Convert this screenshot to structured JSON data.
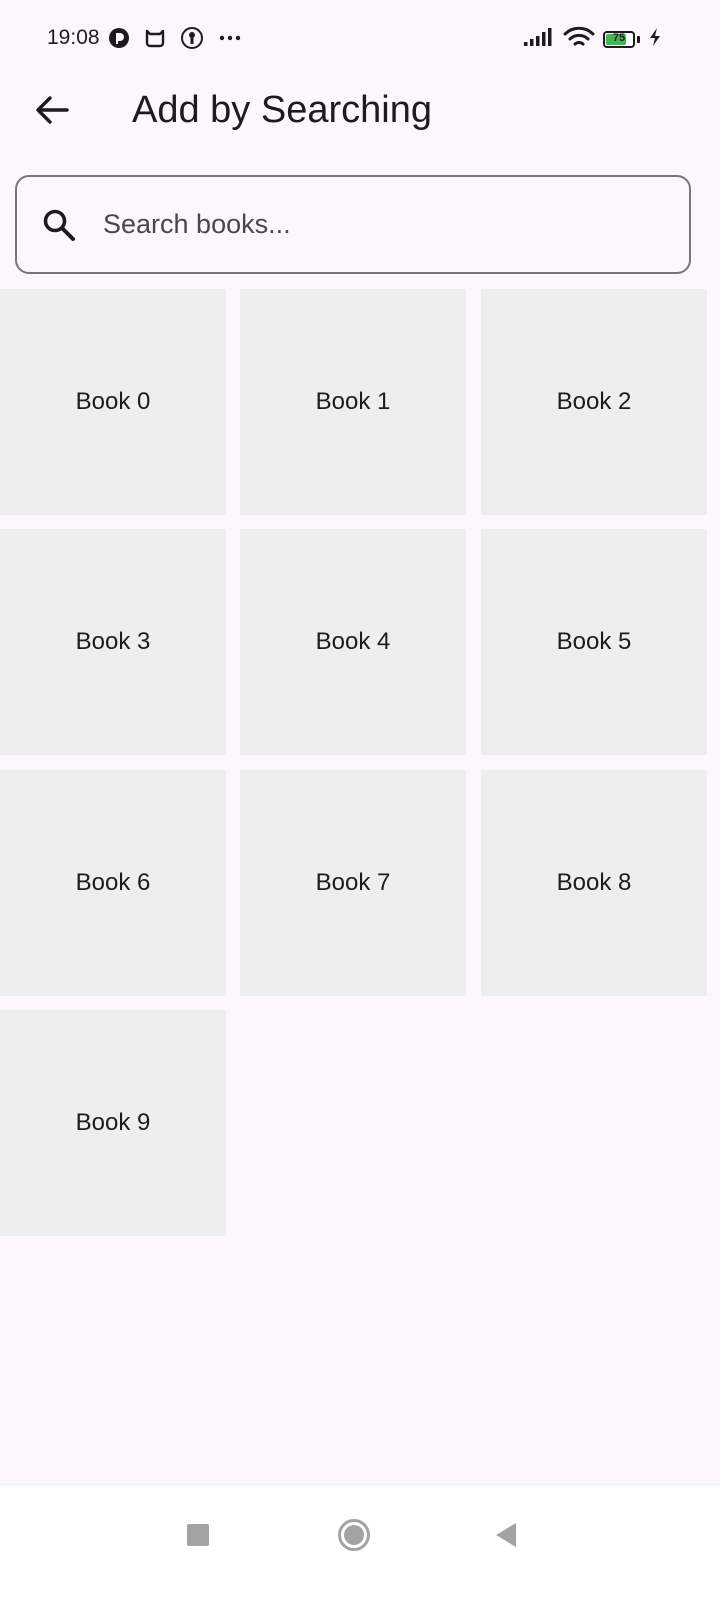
{
  "status_bar": {
    "time": "19:08",
    "left_icons": [
      "notification-icon",
      "mi-icon",
      "keyhole-icon",
      "more-dots-icon"
    ],
    "right_icons": [
      "signal-icon",
      "wifi-icon",
      "battery-icon",
      "charging-icon"
    ],
    "battery_level": "75",
    "battery_fraction": 0.75
  },
  "app_bar": {
    "title": "Add by Searching",
    "back_icon": "arrow-back-icon"
  },
  "search": {
    "placeholder": "Search books...",
    "value": "",
    "icon": "search-icon"
  },
  "books": [
    {
      "label": "Book 0"
    },
    {
      "label": "Book 1"
    },
    {
      "label": "Book 2"
    },
    {
      "label": "Book 3"
    },
    {
      "label": "Book 4"
    },
    {
      "label": "Book 5"
    },
    {
      "label": "Book 6"
    },
    {
      "label": "Book 7"
    },
    {
      "label": "Book 8"
    },
    {
      "label": "Book 9"
    }
  ],
  "nav_bar": {
    "buttons": [
      "recents-square-icon",
      "home-circle-icon",
      "back-triangle-icon"
    ]
  },
  "colors": {
    "background": "#fdf7fd",
    "tile": "#eeeeee",
    "text": "#1d1b20",
    "outline": "#79747e",
    "battery": "#3fb950"
  }
}
